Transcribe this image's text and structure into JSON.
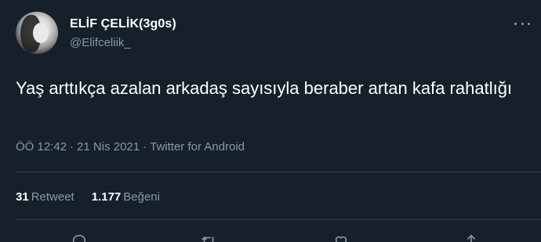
{
  "tweet": {
    "author_name": "ELİF ÇELİK(3g0s)",
    "author_handle": "@Elifceliik_",
    "text": "Yaş arttıkça azalan arkadaş sayısıyla beraber artan kafa rahatlığı",
    "time": "ÖÖ 12:42",
    "date": "21 Nis 2021",
    "source": "Twitter for Android",
    "separator": "·",
    "retweet_count": "31",
    "retweet_label": "Retweet",
    "like_count": "1.177",
    "like_label": "Beğeni"
  },
  "icons": {
    "more": "more-dots-icon",
    "reply": "reply-icon",
    "retweet": "retweet-icon",
    "like": "heart-icon",
    "share": "share-icon"
  },
  "colors": {
    "background": "#15202b",
    "text": "#ffffff",
    "secondary": "#8899a6",
    "divider": "#38444d"
  }
}
